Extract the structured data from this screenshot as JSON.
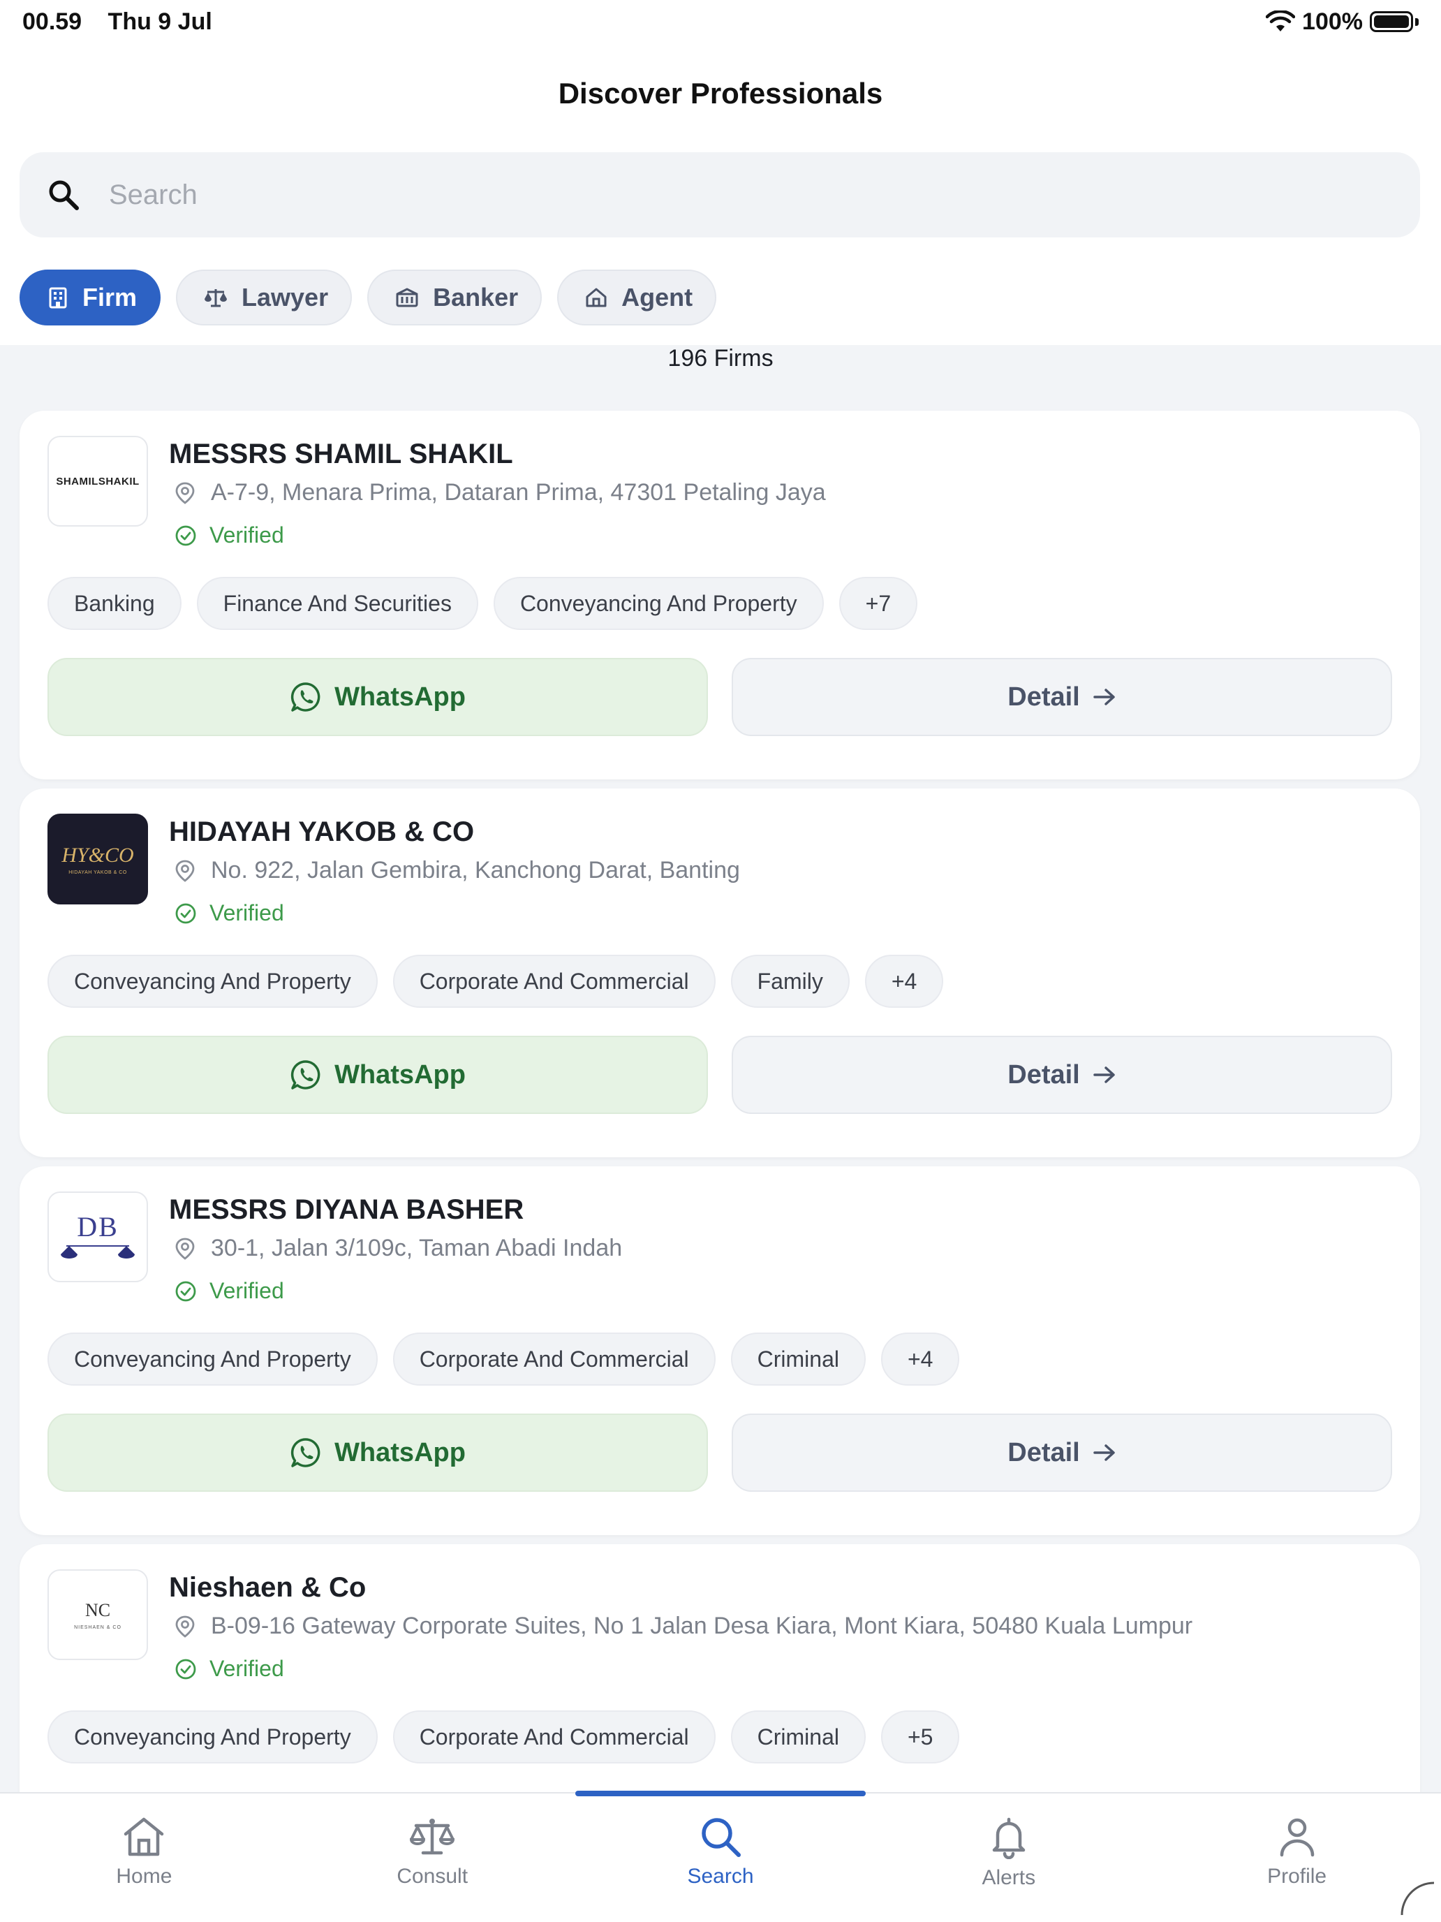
{
  "status_bar": {
    "time": "00.59",
    "date": "Thu 9 Jul",
    "battery": "100%"
  },
  "header": {
    "title": "Discover Professionals"
  },
  "search": {
    "placeholder": "Search"
  },
  "filters": [
    {
      "label": "Firm",
      "icon": "building-icon",
      "active": true
    },
    {
      "label": "Lawyer",
      "icon": "scale-icon",
      "active": false
    },
    {
      "label": "Banker",
      "icon": "bank-icon",
      "active": false
    },
    {
      "label": "Agent",
      "icon": "house-icon",
      "active": false
    }
  ],
  "results": {
    "count_label": "196 Firms"
  },
  "firms": [
    {
      "name": "MESSRS SHAMIL SHAKIL",
      "logo_text": "SHAMILSHAKIL",
      "address": "A-7-9, Menara Prima, Dataran Prima, 47301 Petaling Jaya",
      "verified_label": "Verified",
      "tags": [
        "Banking",
        "Finance And Securities",
        "Conveyancing And Property",
        "+7"
      ],
      "whatsapp_label": "WhatsApp",
      "detail_label": "Detail"
    },
    {
      "name": "HIDAYAH YAKOB & CO",
      "logo_text": "HY&CO",
      "logo_subtext": "HIDAYAH YAKOB & CO",
      "address": "No. 922, Jalan Gembira, Kanchong Darat, Banting",
      "verified_label": "Verified",
      "tags": [
        "Conveyancing And Property",
        "Corporate And Commercial",
        "Family",
        "+4"
      ],
      "whatsapp_label": "WhatsApp",
      "detail_label": "Detail"
    },
    {
      "name": "MESSRS DIYANA BASHER",
      "logo_text": "DB",
      "address": "30-1, Jalan 3/109c, Taman Abadi Indah",
      "verified_label": "Verified",
      "tags": [
        "Conveyancing And Property",
        "Corporate And Commercial",
        "Criminal",
        "+4"
      ],
      "whatsapp_label": "WhatsApp",
      "detail_label": "Detail"
    },
    {
      "name": "Nieshaen & Co",
      "logo_text": "NC",
      "logo_subtext": "NIESHAEN & CO",
      "address": "B-09-16 Gateway Corporate Suites, No 1 Jalan Desa Kiara, Mont Kiara, 50480 Kuala Lumpur",
      "verified_label": "Verified",
      "tags": [
        "Conveyancing And Property",
        "Corporate And Commercial",
        "Criminal",
        "+5"
      ]
    }
  ],
  "bottom_nav": [
    {
      "label": "Home",
      "icon": "home-icon",
      "active": false
    },
    {
      "label": "Consult",
      "icon": "scale-icon",
      "active": false
    },
    {
      "label": "Search",
      "icon": "search-icon",
      "active": true
    },
    {
      "label": "Alerts",
      "icon": "bell-icon",
      "active": false
    },
    {
      "label": "Profile",
      "icon": "user-icon",
      "active": false
    }
  ],
  "colors": {
    "primary": "#2d62c4",
    "verified": "#3d9a4a",
    "whatsapp_bg": "#e6f3e4",
    "whatsapp_text": "#226b33"
  }
}
